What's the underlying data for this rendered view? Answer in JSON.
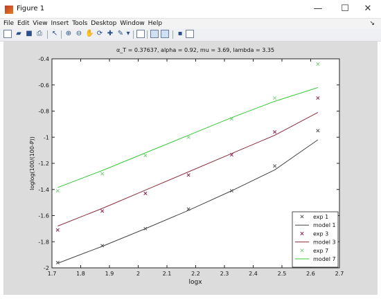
{
  "window": {
    "title": "Figure 1",
    "minimize": "—",
    "maximize": "☐",
    "close": "✕"
  },
  "menu": [
    "File",
    "Edit",
    "View",
    "Insert",
    "Tools",
    "Desktop",
    "Window",
    "Help"
  ],
  "menu_overflow": "↘",
  "toolbar_icons": [
    "new-figure-icon",
    "open-icon",
    "save-icon",
    "print-icon",
    "pointer-icon",
    "zoom-in-icon",
    "zoom-out-icon",
    "pan-icon",
    "rotate-icon",
    "data-cursor-icon",
    "brush-icon",
    "link-plot-icon",
    "colorbar-icon",
    "legend-icon",
    "hide-plot-tools-icon",
    "show-plot-tools-icon"
  ],
  "plot_title": "α_T = 0.37637, alpha = 0.92, mu = 3.69, lambda = 3.35",
  "chart_data": {
    "type": "line",
    "title": "αT = 0.37637, alpha = 0.92, mu = 3.69, lambda = 3.35",
    "xlabel": "logx",
    "ylabel": "loglog(100/(100-P))",
    "xlim": [
      1.7,
      2.7
    ],
    "ylim": [
      -2,
      -0.4
    ],
    "xticks": [
      "1.7",
      "1.8",
      "1.9",
      "2",
      "2.1",
      "2.2",
      "2.3",
      "2.4",
      "2.5",
      "2.6",
      "2.7"
    ],
    "yticks": [
      "-0.4",
      "-0.6",
      "-0.8",
      "-1",
      "-1.2",
      "-1.4",
      "-1.6",
      "-1.8",
      "-2"
    ],
    "grid": false,
    "legend_position": "bottom-right",
    "series": [
      {
        "name": "exp 1",
        "kind": "marker",
        "color": "#555555",
        "x": [
          1.72,
          1.875,
          2.025,
          2.175,
          2.325,
          2.475,
          2.625
        ],
        "y": [
          -1.96,
          -1.83,
          -1.7,
          -1.55,
          -1.41,
          -1.22,
          -0.95
        ]
      },
      {
        "name": "model 1",
        "kind": "line",
        "color": "#444444",
        "x": [
          1.72,
          1.875,
          2.025,
          2.175,
          2.325,
          2.475,
          2.625
        ],
        "y": [
          -1.965,
          -1.835,
          -1.7,
          -1.56,
          -1.41,
          -1.25,
          -1.02
        ]
      },
      {
        "name": "exp 3",
        "kind": "marker",
        "color": "#8b2252",
        "x": [
          1.72,
          1.875,
          2.025,
          2.175,
          2.325,
          2.475,
          2.625
        ],
        "y": [
          -1.71,
          -1.565,
          -1.43,
          -1.29,
          -1.135,
          -0.96,
          -0.7
        ]
      },
      {
        "name": "model 3",
        "kind": "line",
        "color": "#8b2c3a",
        "x": [
          1.72,
          1.875,
          2.025,
          2.175,
          2.325,
          2.475,
          2.625
        ],
        "y": [
          -1.68,
          -1.545,
          -1.405,
          -1.265,
          -1.125,
          -0.985,
          -0.81
        ]
      },
      {
        "name": "exp 7",
        "kind": "marker",
        "color": "#7dcf7d",
        "x": [
          1.72,
          1.875,
          2.025,
          2.175,
          2.325,
          2.475,
          2.625
        ],
        "y": [
          -1.41,
          -1.28,
          -1.14,
          -1.0,
          -0.86,
          -0.7,
          -0.44
        ]
      },
      {
        "name": "model 7",
        "kind": "line",
        "color": "#33cc33",
        "x": [
          1.72,
          1.875,
          2.025,
          2.175,
          2.325,
          2.475,
          2.625
        ],
        "y": [
          -1.385,
          -1.255,
          -1.12,
          -0.985,
          -0.85,
          -0.725,
          -0.62
        ]
      }
    ]
  }
}
